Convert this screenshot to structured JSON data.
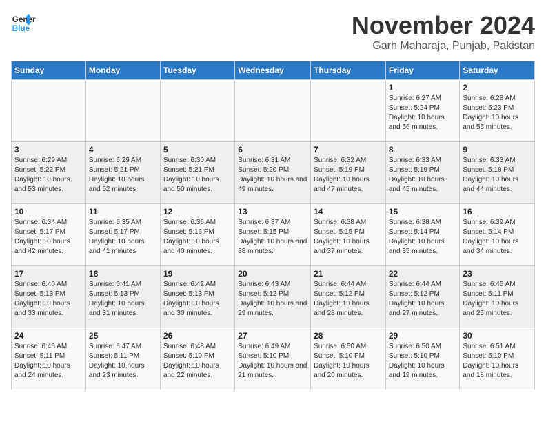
{
  "header": {
    "logo_line1": "General",
    "logo_line2": "Blue",
    "month": "November 2024",
    "location": "Garh Maharaja, Punjab, Pakistan"
  },
  "weekdays": [
    "Sunday",
    "Monday",
    "Tuesday",
    "Wednesday",
    "Thursday",
    "Friday",
    "Saturday"
  ],
  "weeks": [
    [
      {
        "day": "",
        "info": ""
      },
      {
        "day": "",
        "info": ""
      },
      {
        "day": "",
        "info": ""
      },
      {
        "day": "",
        "info": ""
      },
      {
        "day": "",
        "info": ""
      },
      {
        "day": "1",
        "info": "Sunrise: 6:27 AM\nSunset: 5:24 PM\nDaylight: 10 hours and 56 minutes."
      },
      {
        "day": "2",
        "info": "Sunrise: 6:28 AM\nSunset: 5:23 PM\nDaylight: 10 hours and 55 minutes."
      }
    ],
    [
      {
        "day": "3",
        "info": "Sunrise: 6:29 AM\nSunset: 5:22 PM\nDaylight: 10 hours and 53 minutes."
      },
      {
        "day": "4",
        "info": "Sunrise: 6:29 AM\nSunset: 5:21 PM\nDaylight: 10 hours and 52 minutes."
      },
      {
        "day": "5",
        "info": "Sunrise: 6:30 AM\nSunset: 5:21 PM\nDaylight: 10 hours and 50 minutes."
      },
      {
        "day": "6",
        "info": "Sunrise: 6:31 AM\nSunset: 5:20 PM\nDaylight: 10 hours and 49 minutes."
      },
      {
        "day": "7",
        "info": "Sunrise: 6:32 AM\nSunset: 5:19 PM\nDaylight: 10 hours and 47 minutes."
      },
      {
        "day": "8",
        "info": "Sunrise: 6:33 AM\nSunset: 5:19 PM\nDaylight: 10 hours and 45 minutes."
      },
      {
        "day": "9",
        "info": "Sunrise: 6:33 AM\nSunset: 5:18 PM\nDaylight: 10 hours and 44 minutes."
      }
    ],
    [
      {
        "day": "10",
        "info": "Sunrise: 6:34 AM\nSunset: 5:17 PM\nDaylight: 10 hours and 42 minutes."
      },
      {
        "day": "11",
        "info": "Sunrise: 6:35 AM\nSunset: 5:17 PM\nDaylight: 10 hours and 41 minutes."
      },
      {
        "day": "12",
        "info": "Sunrise: 6:36 AM\nSunset: 5:16 PM\nDaylight: 10 hours and 40 minutes."
      },
      {
        "day": "13",
        "info": "Sunrise: 6:37 AM\nSunset: 5:15 PM\nDaylight: 10 hours and 38 minutes."
      },
      {
        "day": "14",
        "info": "Sunrise: 6:38 AM\nSunset: 5:15 PM\nDaylight: 10 hours and 37 minutes."
      },
      {
        "day": "15",
        "info": "Sunrise: 6:38 AM\nSunset: 5:14 PM\nDaylight: 10 hours and 35 minutes."
      },
      {
        "day": "16",
        "info": "Sunrise: 6:39 AM\nSunset: 5:14 PM\nDaylight: 10 hours and 34 minutes."
      }
    ],
    [
      {
        "day": "17",
        "info": "Sunrise: 6:40 AM\nSunset: 5:13 PM\nDaylight: 10 hours and 33 minutes."
      },
      {
        "day": "18",
        "info": "Sunrise: 6:41 AM\nSunset: 5:13 PM\nDaylight: 10 hours and 31 minutes."
      },
      {
        "day": "19",
        "info": "Sunrise: 6:42 AM\nSunset: 5:13 PM\nDaylight: 10 hours and 30 minutes."
      },
      {
        "day": "20",
        "info": "Sunrise: 6:43 AM\nSunset: 5:12 PM\nDaylight: 10 hours and 29 minutes."
      },
      {
        "day": "21",
        "info": "Sunrise: 6:44 AM\nSunset: 5:12 PM\nDaylight: 10 hours and 28 minutes."
      },
      {
        "day": "22",
        "info": "Sunrise: 6:44 AM\nSunset: 5:12 PM\nDaylight: 10 hours and 27 minutes."
      },
      {
        "day": "23",
        "info": "Sunrise: 6:45 AM\nSunset: 5:11 PM\nDaylight: 10 hours and 25 minutes."
      }
    ],
    [
      {
        "day": "24",
        "info": "Sunrise: 6:46 AM\nSunset: 5:11 PM\nDaylight: 10 hours and 24 minutes."
      },
      {
        "day": "25",
        "info": "Sunrise: 6:47 AM\nSunset: 5:11 PM\nDaylight: 10 hours and 23 minutes."
      },
      {
        "day": "26",
        "info": "Sunrise: 6:48 AM\nSunset: 5:10 PM\nDaylight: 10 hours and 22 minutes."
      },
      {
        "day": "27",
        "info": "Sunrise: 6:49 AM\nSunset: 5:10 PM\nDaylight: 10 hours and 21 minutes."
      },
      {
        "day": "28",
        "info": "Sunrise: 6:50 AM\nSunset: 5:10 PM\nDaylight: 10 hours and 20 minutes."
      },
      {
        "day": "29",
        "info": "Sunrise: 6:50 AM\nSunset: 5:10 PM\nDaylight: 10 hours and 19 minutes."
      },
      {
        "day": "30",
        "info": "Sunrise: 6:51 AM\nSunset: 5:10 PM\nDaylight: 10 hours and 18 minutes."
      }
    ]
  ]
}
